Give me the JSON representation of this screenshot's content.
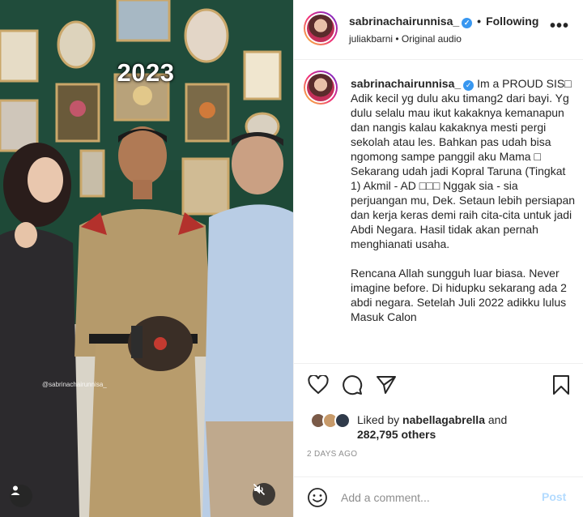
{
  "media": {
    "year_overlay": "2023",
    "watermark": "@sabrinachairunnisa_",
    "icons": [
      "user-tag-icon",
      "mute-icon"
    ]
  },
  "header": {
    "username": "sabrinachairunnisa_",
    "separator": "•",
    "follow_status": "Following",
    "audio": "juliakbarni • Original audio",
    "more": "•••"
  },
  "caption": {
    "username": "sabrinachairunnisa_",
    "text": "Im a PROUD SIS□ Adik kecil yg dulu aku timang2 dari bayi. Yg dulu selalu mau ikut kakaknya kemanapun dan nangis kalau kakaknya mesti pergi sekolah atau les. Bahkan pas udah bisa ngomong sampe panggil aku Mama □ Sekarang udah jadi Kopral Taruna (Tingkat 1) Akmil - AD □□□ Nggak sia - sia perjuangan mu, Dek. Setaun lebih persiapan dan kerja keras demi raih cita-cita untuk jadi Abdi Negara. Hasil tidak akan pernah menghianati usaha.\n\nRencana Allah sungguh luar biasa. Never imagine before. Di hidupku sekarang ada 2 abdi negara. Setelah Juli 2022 adikku lulus Masuk Calon"
  },
  "actions": {
    "like_icon": "heart-icon",
    "comment_icon": "comment-icon",
    "share_icon": "share-icon",
    "save_icon": "bookmark-icon"
  },
  "likes": {
    "prefix": "Liked by ",
    "liker": "nabellagabrella",
    "middle": " and",
    "count": "282,795 others"
  },
  "date": "2 DAYS AGO",
  "comment": {
    "placeholder": "Add a comment...",
    "post_label": "Post"
  },
  "colors": {
    "verified": "#3897f0",
    "post_disabled": "#b3dbff",
    "wall_green": "#1f4a3a"
  }
}
